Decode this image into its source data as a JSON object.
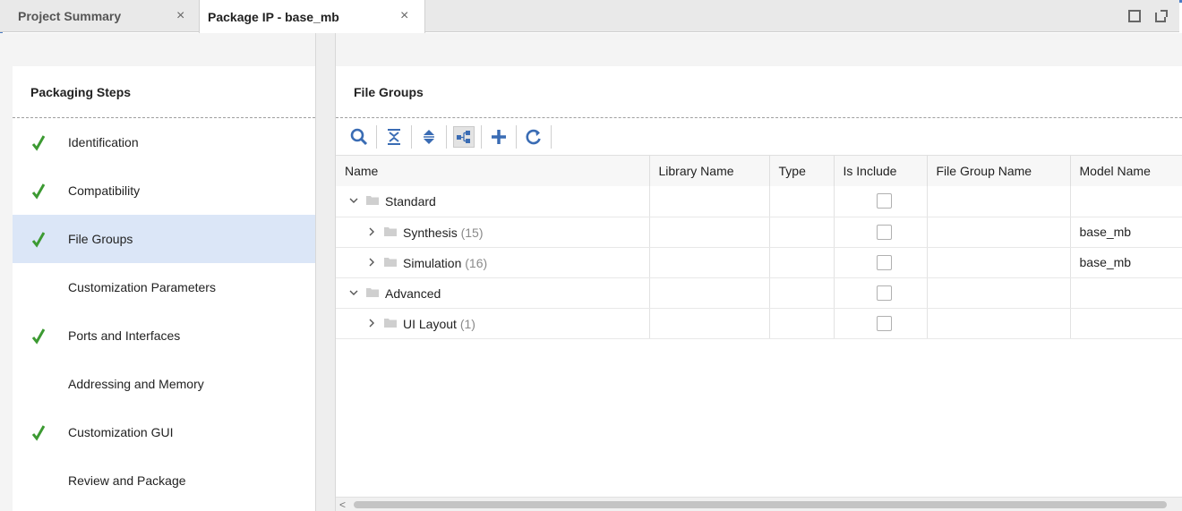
{
  "tabs": [
    {
      "label": "Project Summary",
      "close": "×"
    },
    {
      "label": "Package IP - base_mb",
      "close": "×"
    }
  ],
  "left_pane": {
    "title": "Packaging Steps",
    "steps": [
      {
        "label": "Identification",
        "done": true
      },
      {
        "label": "Compatibility",
        "done": true
      },
      {
        "label": "File Groups",
        "done": true,
        "selected": true
      },
      {
        "label": "Customization Parameters",
        "done": false
      },
      {
        "label": "Ports and Interfaces",
        "done": true
      },
      {
        "label": "Addressing and Memory",
        "done": false
      },
      {
        "label": "Customization GUI",
        "done": true
      },
      {
        "label": "Review and Package",
        "done": false
      }
    ]
  },
  "right_pane": {
    "title": "File Groups",
    "toolbar": [
      "search-icon",
      "collapse-all-icon",
      "expand-all-icon",
      "hierarchy-icon",
      "add-icon",
      "refresh-icon"
    ],
    "columns": [
      "Name",
      "Library Name",
      "Type",
      "Is Include",
      "File Group Name",
      "Model Name"
    ],
    "rows": [
      {
        "name": "Standard",
        "count": "",
        "model": "",
        "expanded": true
      },
      {
        "name": "Synthesis",
        "count": "(15)",
        "model": "base_mb",
        "expanded": false
      },
      {
        "name": "Simulation",
        "count": "(16)",
        "model": "base_mb",
        "expanded": false
      },
      {
        "name": "Advanced",
        "count": "",
        "model": "",
        "expanded": true
      },
      {
        "name": "UI Layout",
        "count": "(1)",
        "model": "",
        "expanded": false
      }
    ]
  },
  "colors": {
    "accent": "#4a7bc4",
    "check": "#3c9a32",
    "selected": "#dbe6f7",
    "icon": "#3a6cb4"
  }
}
